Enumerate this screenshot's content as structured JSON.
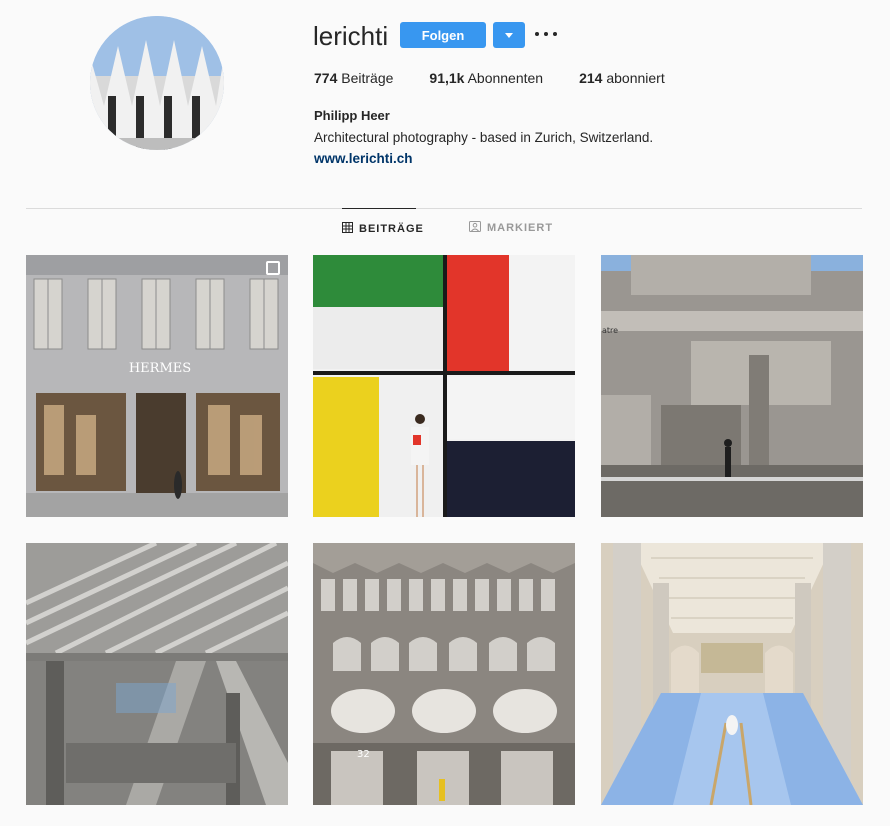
{
  "profile": {
    "username": "lerichti",
    "follow_label": "Folgen",
    "full_name": "Philipp Heer",
    "bio": "Architectural photography - based in Zurich, Switzerland.",
    "website": "www.lerichti.ch",
    "avatar_icon": "profile-photo-white-spikes-facade"
  },
  "stats": {
    "posts_count": "774",
    "posts_label": "Beiträge",
    "followers_count": "91,1k",
    "followers_label": "Abonnenten",
    "following_count": "214",
    "following_label": "abonniert"
  },
  "tabs": [
    {
      "label": "BEITRÄGE",
      "icon": "grid-icon",
      "active": true
    },
    {
      "label": "MARKIERT",
      "icon": "tagged-icon",
      "active": false
    }
  ],
  "posts": [
    {
      "subject": "hermes-glass-brick-store",
      "sign": "HERMES",
      "multi": true
    },
    {
      "subject": "mondrian-color-wall"
    },
    {
      "subject": "brutalist-concrete-stair-tower",
      "sign": "atre"
    },
    {
      "subject": "station-steel-ceiling"
    },
    {
      "subject": "concrete-arched-facade",
      "sign": "32"
    },
    {
      "subject": "marble-columns-pool-hall"
    }
  ],
  "colors": {
    "accent": "#3897f0",
    "link": "#003569",
    "text": "#262626",
    "muted": "#999999",
    "background": "#fafafa",
    "divider": "#dbdbdb"
  }
}
